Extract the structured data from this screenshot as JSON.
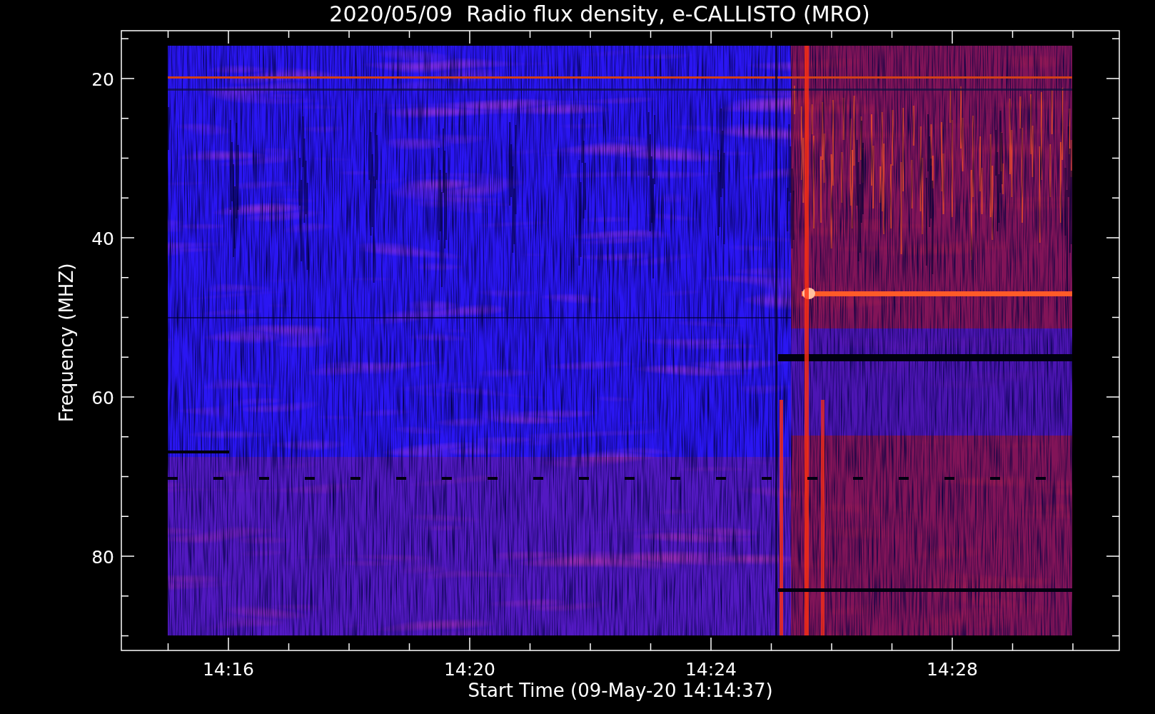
{
  "title": "2020/05/09  Radio flux density, e-CALLISTO (MRO)",
  "plot": {
    "ylabel": "Frequency (MHZ)",
    "xlabel": "Start Time (09-May-20 14:14:37)",
    "y_tick_labels": [
      "20",
      "40",
      "60",
      "80"
    ],
    "x_tick_labels": [
      "14:16",
      "14:20",
      "14:24",
      "14:28"
    ]
  }
}
